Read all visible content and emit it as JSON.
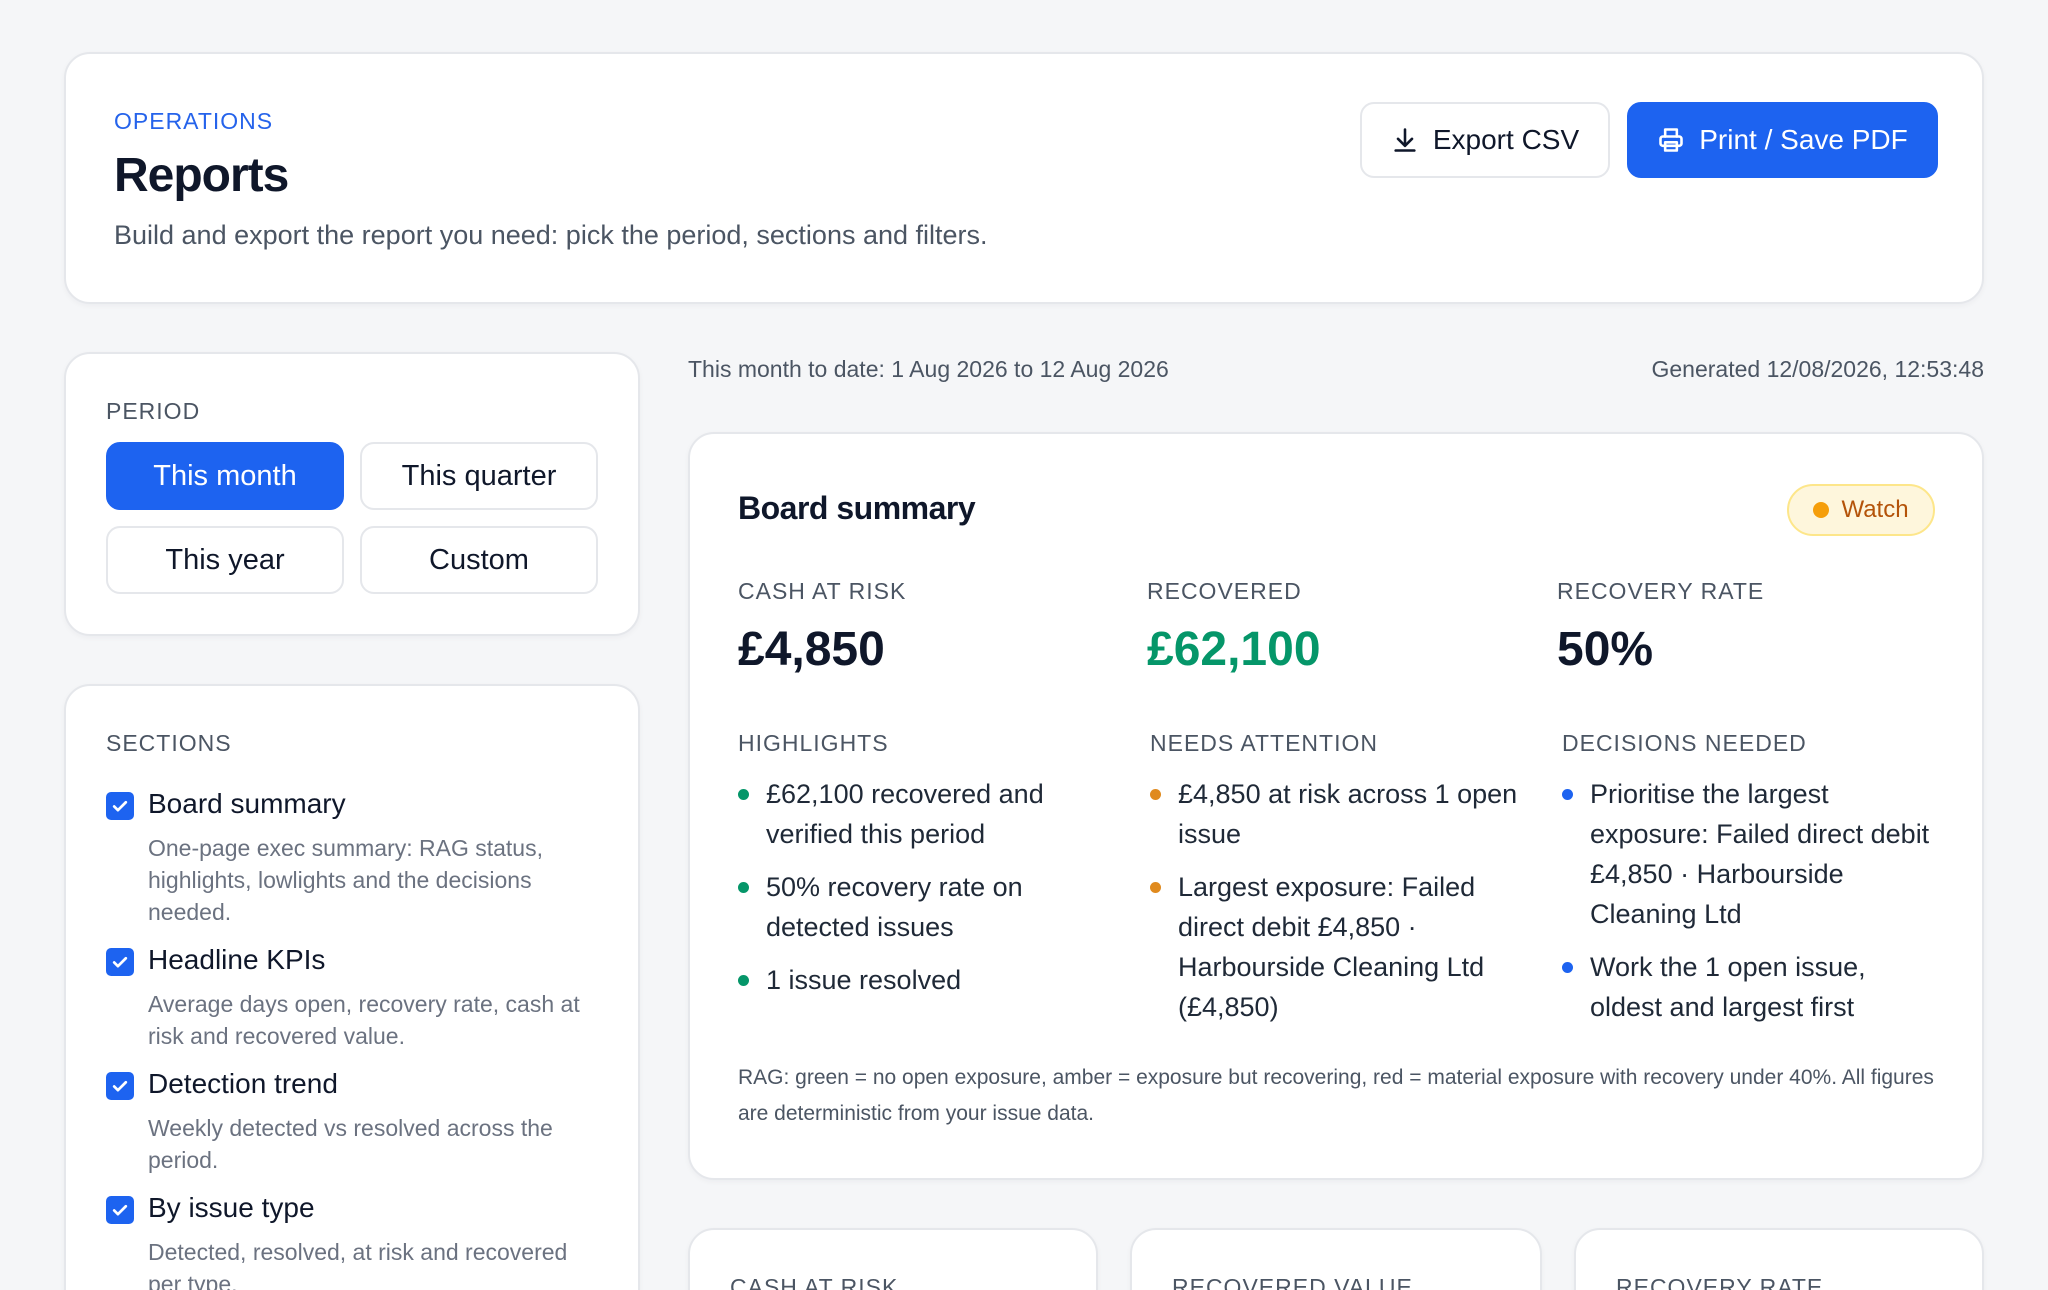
{
  "header": {
    "eyebrow": "OPERATIONS",
    "title": "Reports",
    "subtitle": "Build and export the report you need: pick the period, sections and filters.",
    "export_label": "Export CSV",
    "print_label": "Print / Save PDF"
  },
  "period": {
    "label": "PERIOD",
    "options": [
      "This month",
      "This quarter",
      "This year",
      "Custom"
    ],
    "selected": "This month"
  },
  "sections": {
    "label": "SECTIONS",
    "items": [
      {
        "title": "Board summary",
        "description": "One-page exec summary: RAG status, highlights, lowlights and the decisions needed.",
        "checked": true
      },
      {
        "title": "Headline KPIs",
        "description": "Average days open, recovery rate, cash at risk and recovered value.",
        "checked": true
      },
      {
        "title": "Detection trend",
        "description": "Weekly detected vs resolved across the period.",
        "checked": true
      },
      {
        "title": "By issue type",
        "description": "Detected, resolved, at risk and recovered per type.",
        "checked": true
      }
    ]
  },
  "meta": {
    "range": "This month to date: 1 Aug 2026 to 12 Aug 2026",
    "generated": "Generated 12/08/2026, 12:53:48"
  },
  "board": {
    "title": "Board summary",
    "rag_status": "Watch",
    "kpis": [
      {
        "label": "CASH AT RISK",
        "value": "£4,850"
      },
      {
        "label": "RECOVERED",
        "value": "£62,100"
      },
      {
        "label": "RECOVERY RATE",
        "value": "50%"
      }
    ],
    "highlights": {
      "title": "HIGHLIGHTS",
      "items": [
        "£62,100 recovered and verified this period",
        "50% recovery rate on detected issues",
        "1 issue resolved"
      ]
    },
    "attention": {
      "title": "NEEDS ATTENTION",
      "items": [
        "£4,850 at risk across 1 open issue",
        "Largest exposure: Failed direct debit £4,850 · Harbourside Cleaning Ltd (£4,850)"
      ]
    },
    "decisions": {
      "title": "DECISIONS NEEDED",
      "items": [
        "Prioritise the largest exposure: Failed direct debit £4,850 · Harbourside Cleaning Ltd",
        "Work the 1 open issue, oldest and largest first"
      ]
    },
    "rag_note": "RAG: green = no open exposure, amber = exposure but recovering, red = material exposure with recovery under 40%. All figures are deterministic from your issue data."
  },
  "bottom_cards": {
    "labels": [
      "CASH AT RISK",
      "RECOVERED VALUE",
      "RECOVERY RATE"
    ]
  },
  "colors": {
    "accent": "#1d63f0",
    "eyebrow": "#2563eb",
    "recovered_green": "#059669",
    "amber": "#e08a1e",
    "badge_bg": "#fef6dc",
    "page_bg": "#f5f6f8"
  },
  "icons": {
    "export": "download-icon",
    "print": "printer-icon",
    "checkbox": "check-icon",
    "rag": "status-dot-icon"
  }
}
